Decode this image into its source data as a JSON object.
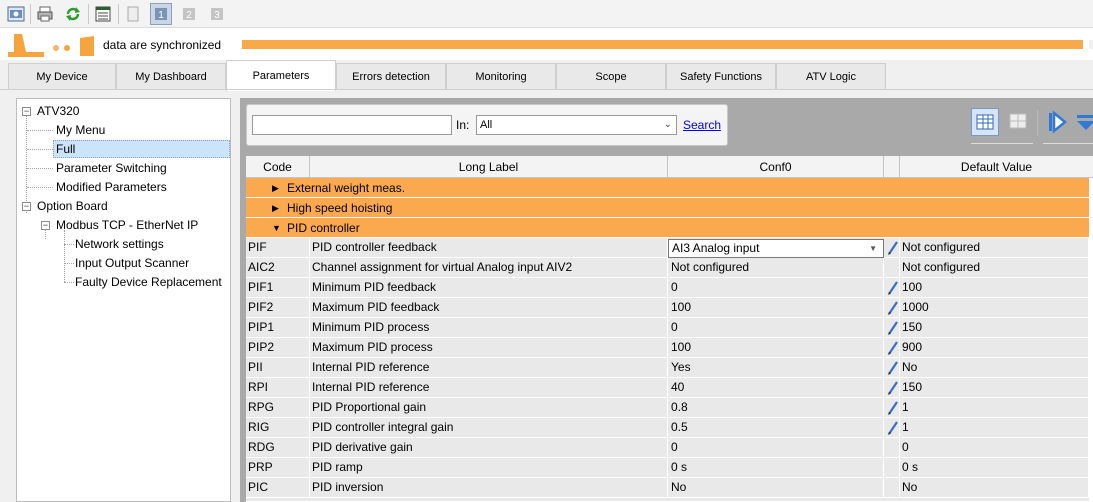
{
  "toolbar": {
    "buttons": [
      {
        "icon": "device-settings-icon"
      },
      {
        "icon": "print-icon"
      },
      {
        "icon": "refresh-icon"
      },
      {
        "icon": "table-view-icon"
      },
      {
        "icon": "document-icon"
      },
      {
        "icon": "step-1-icon"
      },
      {
        "icon": "step-2-icon"
      },
      {
        "icon": "step-3-icon"
      }
    ]
  },
  "sync": {
    "status_text": "data are synchronized",
    "progress_percent": 100,
    "progress_color": "#f8a94a"
  },
  "tabs": [
    {
      "label": "My Device"
    },
    {
      "label": "My Dashboard"
    },
    {
      "label": "Parameters"
    },
    {
      "label": "Errors detection"
    },
    {
      "label": "Monitoring"
    },
    {
      "label": "Scope"
    },
    {
      "label": "Safety Functions"
    },
    {
      "label": "ATV Logic"
    }
  ],
  "active_tab": "Parameters",
  "tree": {
    "root": "ATV320",
    "my_menu": "My Menu",
    "full": "Full",
    "param_switching": "Parameter Switching",
    "modified": "Modified Parameters",
    "option_board": "Option Board",
    "modbus": "Modbus TCP - EtherNet IP",
    "network": "Network settings",
    "io_scanner": "Input Output Scanner",
    "faulty": "Faulty Device Replacement"
  },
  "search": {
    "input_value": "",
    "in_label": "In:",
    "in_value": "All",
    "button_label": "Search"
  },
  "table": {
    "headers": {
      "code": "Code",
      "label": "Long Label",
      "conf": "Conf0",
      "default": "Default Value"
    },
    "groups": [
      {
        "label": "External weight meas.",
        "expanded": false
      },
      {
        "label": "High speed hoisting",
        "expanded": false
      },
      {
        "label": "PID controller",
        "expanded": true
      }
    ],
    "rows": [
      {
        "code": "PIF",
        "label": "PID controller feedback",
        "conf": "AI3 Analog input",
        "default": "Not configured"
      },
      {
        "code": "AIC2",
        "label": "Channel assignment for virtual Analog input AIV2",
        "conf": "Not configured",
        "default": "Not configured"
      },
      {
        "code": "PIF1",
        "label": "Minimum PID feedback",
        "conf": "0",
        "default": "100"
      },
      {
        "code": "PIF2",
        "label": "Maximum PID feedback",
        "conf": "100",
        "default": "1000"
      },
      {
        "code": "PIP1",
        "label": "Minimum PID process",
        "conf": "0",
        "default": "150"
      },
      {
        "code": "PIP2",
        "label": "Maximum PID process",
        "conf": "100",
        "default": "900"
      },
      {
        "code": "PII",
        "label": "Internal PID reference",
        "conf": "Yes",
        "default": "No"
      },
      {
        "code": "RPI",
        "label": "Internal PID reference",
        "conf": "40",
        "default": "150"
      },
      {
        "code": "RPG",
        "label": "PID Proportional gain",
        "conf": "0.8",
        "default": "1"
      },
      {
        "code": "RIG",
        "label": "PID controller integral gain",
        "conf": "0.5",
        "default": "1"
      },
      {
        "code": "RDG",
        "label": "PID derivative gain",
        "conf": "0",
        "default": "0"
      },
      {
        "code": "PRP",
        "label": "PID ramp",
        "conf": "0 s",
        "default": "0 s"
      },
      {
        "code": "PIC",
        "label": "PID inversion",
        "conf": "No",
        "default": "No"
      }
    ]
  },
  "colors": {
    "accent_orange": "#fba94e",
    "row_bg": "#e9e9e9",
    "link": "#0000ee",
    "selection": "#cce4f7"
  }
}
